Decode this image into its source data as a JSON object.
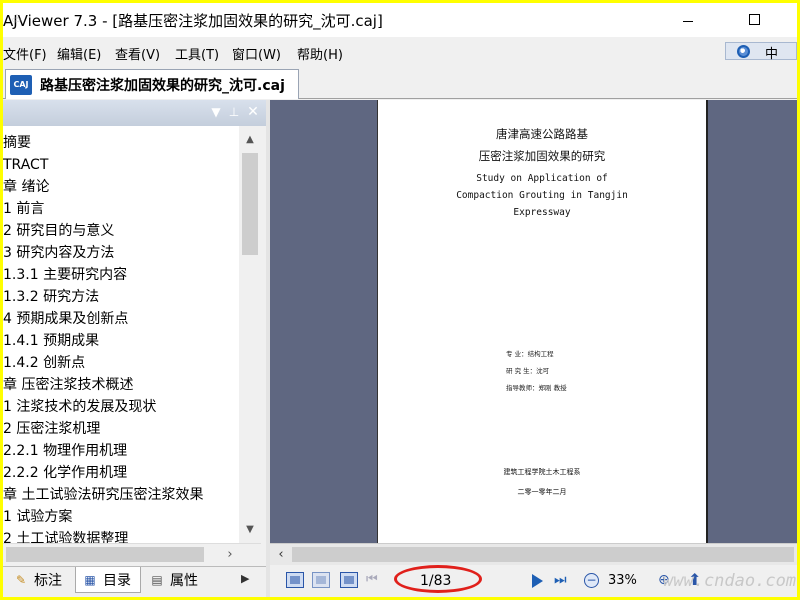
{
  "window": {
    "title": "AJViewer 7.3 - [路基压密注浆加固效果的研究_沈可.caj]"
  },
  "menu": {
    "items": [
      "文件(F)",
      "编辑(E)",
      "查看(V)",
      "工具(T)",
      "窗口(W)",
      "帮助(H)"
    ],
    "lang_label": "中"
  },
  "doc_tab": {
    "icon_text": "CAJ",
    "label": "路基压密注浆加固效果的研究_沈可.caj"
  },
  "toc": {
    "items": [
      "摘要",
      "TRACT",
      "章 绪论",
      "1 前言",
      "2 研究目的与意义",
      "3 研究内容及方法",
      "1.3.1 主要研究内容",
      "1.3.2 研究方法",
      "4 预期成果及创新点",
      "1.4.1 预期成果",
      "1.4.2 创新点",
      "章 压密注浆技术概述",
      "1 注浆技术的发展及现状",
      "2 压密注浆机理",
      "2.2.1 物理作用机理",
      "2.2.2 化学作用机理",
      "章 土工试验法研究压密注浆效果",
      "1 试验方案",
      "2 土工试验数据整理"
    ]
  },
  "panel_tabs": [
    {
      "label": "标注",
      "icon": "pencil-icon"
    },
    {
      "label": "目录",
      "icon": "list-icon"
    },
    {
      "label": "属性",
      "icon": "properties-icon"
    }
  ],
  "page": {
    "title_cn_1": "唐津高速公路路基",
    "title_cn_2": "压密注浆加固效果的研究",
    "title_en_1": "Study on Application of",
    "title_en_2": "Compaction Grouting in Tangjin",
    "title_en_3": "Expressway",
    "major": "专    业：结构工程",
    "student": "研 究 生：沈可",
    "advisor": "指导教师：郑刚 教授",
    "school": "建筑工程学院土木工程系",
    "date": "二零一零年二月"
  },
  "status": {
    "page_number": "1/83",
    "zoom": "33%"
  },
  "watermark": "www.cndao.com",
  "colors": {
    "viewer_bg": "#5f6781",
    "highlight_ellipse": "#e0201b",
    "frame": "#ffff00"
  }
}
